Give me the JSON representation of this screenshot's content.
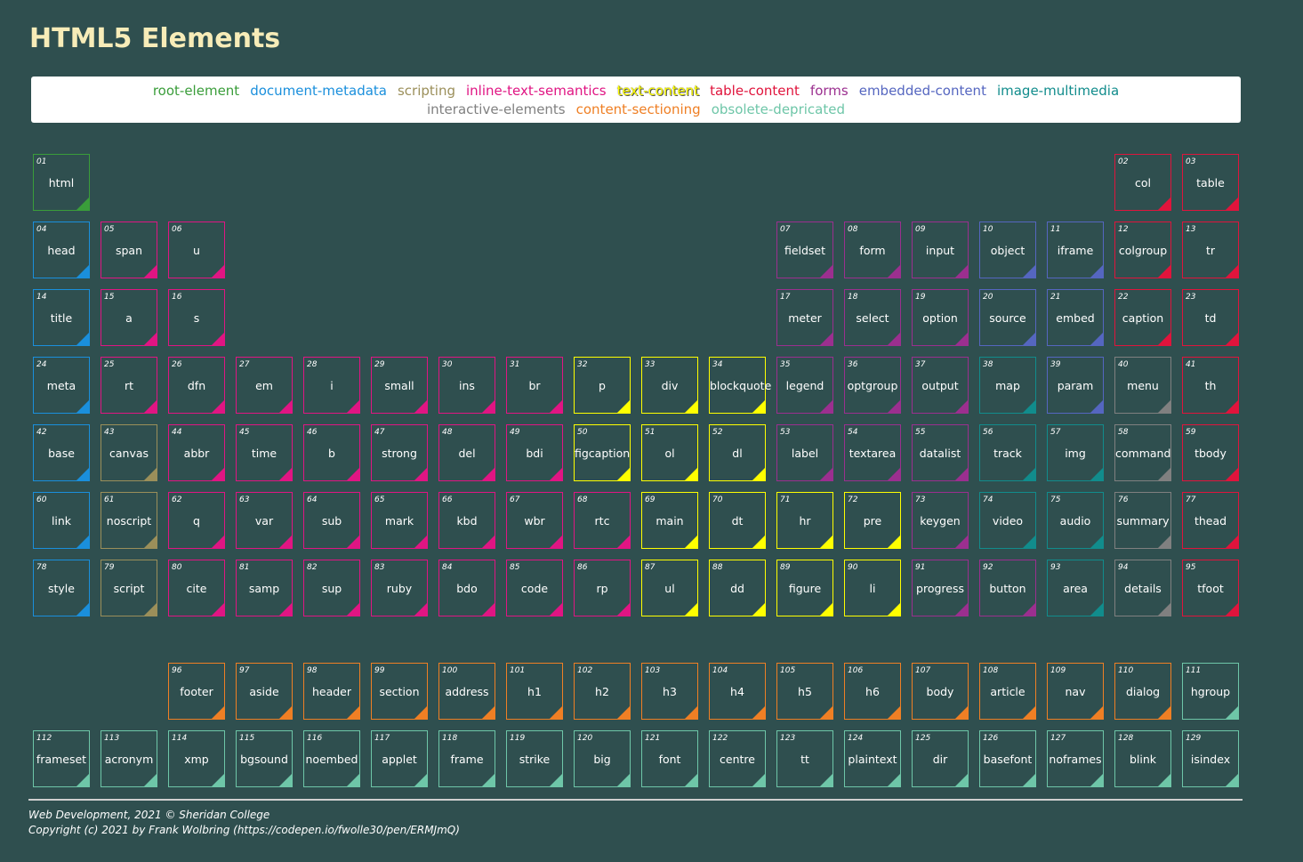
{
  "page": {
    "title": "HTML5 Elements"
  },
  "colors": {
    "background": "#2f4f4f",
    "title": "#f7ecb8",
    "root-element": "#3a9d3a",
    "document-metadata": "#1a8fdc",
    "scripting": "#9b8f5a",
    "inline-text-semantics": "#e01583",
    "text-content": "#ffff00",
    "table-content": "#e0143c",
    "forms": "#9b2f8f",
    "embedded-content": "#5566c0",
    "image-multimedia": "#118c8c",
    "interactive-elements": "#808080",
    "content-sectioning": "#ef7f24",
    "obsolete-depricated": "#6ec6a8"
  },
  "legend": {
    "row1": [
      {
        "key": "root-element",
        "label": "root-element"
      },
      {
        "key": "document-metadata",
        "label": "document-metadata"
      },
      {
        "key": "scripting",
        "label": "scripting"
      },
      {
        "key": "inline-text-semantics",
        "label": "inline-text-semantics"
      },
      {
        "key": "text-content",
        "label": "text-content"
      },
      {
        "key": "table-content",
        "label": "table-content"
      },
      {
        "key": "forms",
        "label": "forms"
      },
      {
        "key": "embedded-content",
        "label": "embedded-content"
      },
      {
        "key": "image-multimedia",
        "label": "image-multimedia"
      }
    ],
    "row2": [
      {
        "key": "interactive-elements",
        "label": "interactive-elements"
      },
      {
        "key": "content-sectioning",
        "label": "content-sectioning"
      },
      {
        "key": "obsolete-depricated",
        "label": "obsolete-depricated"
      }
    ]
  },
  "elements": [
    {
      "num": "01",
      "name": "html",
      "cat": "root-element",
      "row": 0,
      "col": 0
    },
    {
      "num": "02",
      "name": "col",
      "cat": "table-content",
      "row": 0,
      "col": 16
    },
    {
      "num": "03",
      "name": "table",
      "cat": "table-content",
      "row": 0,
      "col": 17
    },
    {
      "num": "04",
      "name": "head",
      "cat": "document-metadata",
      "row": 1,
      "col": 0
    },
    {
      "num": "05",
      "name": "span",
      "cat": "inline-text-semantics",
      "row": 1,
      "col": 1
    },
    {
      "num": "06",
      "name": "u",
      "cat": "inline-text-semantics",
      "row": 1,
      "col": 2
    },
    {
      "num": "07",
      "name": "fieldset",
      "cat": "forms",
      "row": 1,
      "col": 11
    },
    {
      "num": "08",
      "name": "form",
      "cat": "forms",
      "row": 1,
      "col": 12
    },
    {
      "num": "09",
      "name": "input",
      "cat": "forms",
      "row": 1,
      "col": 13
    },
    {
      "num": "10",
      "name": "object",
      "cat": "embedded-content",
      "row": 1,
      "col": 14
    },
    {
      "num": "11",
      "name": "iframe",
      "cat": "embedded-content",
      "row": 1,
      "col": 15
    },
    {
      "num": "12",
      "name": "colgroup",
      "cat": "table-content",
      "row": 1,
      "col": 16
    },
    {
      "num": "13",
      "name": "tr",
      "cat": "table-content",
      "row": 1,
      "col": 17
    },
    {
      "num": "14",
      "name": "title",
      "cat": "document-metadata",
      "row": 2,
      "col": 0
    },
    {
      "num": "15",
      "name": "a",
      "cat": "inline-text-semantics",
      "row": 2,
      "col": 1
    },
    {
      "num": "16",
      "name": "s",
      "cat": "inline-text-semantics",
      "row": 2,
      "col": 2
    },
    {
      "num": "17",
      "name": "meter",
      "cat": "forms",
      "row": 2,
      "col": 11
    },
    {
      "num": "18",
      "name": "select",
      "cat": "forms",
      "row": 2,
      "col": 12
    },
    {
      "num": "19",
      "name": "option",
      "cat": "forms",
      "row": 2,
      "col": 13
    },
    {
      "num": "20",
      "name": "source",
      "cat": "embedded-content",
      "row": 2,
      "col": 14
    },
    {
      "num": "21",
      "name": "embed",
      "cat": "embedded-content",
      "row": 2,
      "col": 15
    },
    {
      "num": "22",
      "name": "caption",
      "cat": "table-content",
      "row": 2,
      "col": 16
    },
    {
      "num": "23",
      "name": "td",
      "cat": "table-content",
      "row": 2,
      "col": 17
    },
    {
      "num": "24",
      "name": "meta",
      "cat": "document-metadata",
      "row": 3,
      "col": 0
    },
    {
      "num": "25",
      "name": "rt",
      "cat": "inline-text-semantics",
      "row": 3,
      "col": 1
    },
    {
      "num": "26",
      "name": "dfn",
      "cat": "inline-text-semantics",
      "row": 3,
      "col": 2
    },
    {
      "num": "27",
      "name": "em",
      "cat": "inline-text-semantics",
      "row": 3,
      "col": 3
    },
    {
      "num": "28",
      "name": "i",
      "cat": "inline-text-semantics",
      "row": 3,
      "col": 4
    },
    {
      "num": "29",
      "name": "small",
      "cat": "inline-text-semantics",
      "row": 3,
      "col": 5
    },
    {
      "num": "30",
      "name": "ins",
      "cat": "inline-text-semantics",
      "row": 3,
      "col": 6
    },
    {
      "num": "31",
      "name": "br",
      "cat": "inline-text-semantics",
      "row": 3,
      "col": 7
    },
    {
      "num": "32",
      "name": "p",
      "cat": "text-content",
      "row": 3,
      "col": 8
    },
    {
      "num": "33",
      "name": "div",
      "cat": "text-content",
      "row": 3,
      "col": 9
    },
    {
      "num": "34",
      "name": "blockquote",
      "cat": "text-content",
      "row": 3,
      "col": 10
    },
    {
      "num": "35",
      "name": "legend",
      "cat": "forms",
      "row": 3,
      "col": 11
    },
    {
      "num": "36",
      "name": "optgroup",
      "cat": "forms",
      "row": 3,
      "col": 12
    },
    {
      "num": "37",
      "name": "output",
      "cat": "forms",
      "row": 3,
      "col": 13
    },
    {
      "num": "38",
      "name": "map",
      "cat": "image-multimedia",
      "row": 3,
      "col": 14
    },
    {
      "num": "39",
      "name": "param",
      "cat": "embedded-content",
      "row": 3,
      "col": 15
    },
    {
      "num": "40",
      "name": "menu",
      "cat": "interactive-elements",
      "row": 3,
      "col": 16
    },
    {
      "num": "41",
      "name": "th",
      "cat": "table-content",
      "row": 3,
      "col": 17
    },
    {
      "num": "42",
      "name": "base",
      "cat": "document-metadata",
      "row": 4,
      "col": 0
    },
    {
      "num": "43",
      "name": "canvas",
      "cat": "scripting",
      "row": 4,
      "col": 1
    },
    {
      "num": "44",
      "name": "abbr",
      "cat": "inline-text-semantics",
      "row": 4,
      "col": 2
    },
    {
      "num": "45",
      "name": "time",
      "cat": "inline-text-semantics",
      "row": 4,
      "col": 3
    },
    {
      "num": "46",
      "name": "b",
      "cat": "inline-text-semantics",
      "row": 4,
      "col": 4
    },
    {
      "num": "47",
      "name": "strong",
      "cat": "inline-text-semantics",
      "row": 4,
      "col": 5
    },
    {
      "num": "48",
      "name": "del",
      "cat": "inline-text-semantics",
      "row": 4,
      "col": 6
    },
    {
      "num": "49",
      "name": "bdi",
      "cat": "inline-text-semantics",
      "row": 4,
      "col": 7
    },
    {
      "num": "50",
      "name": "figcaption",
      "cat": "text-content",
      "row": 4,
      "col": 8
    },
    {
      "num": "51",
      "name": "ol",
      "cat": "text-content",
      "row": 4,
      "col": 9
    },
    {
      "num": "52",
      "name": "dl",
      "cat": "text-content",
      "row": 4,
      "col": 10
    },
    {
      "num": "53",
      "name": "label",
      "cat": "forms",
      "row": 4,
      "col": 11
    },
    {
      "num": "54",
      "name": "textarea",
      "cat": "forms",
      "row": 4,
      "col": 12
    },
    {
      "num": "55",
      "name": "datalist",
      "cat": "forms",
      "row": 4,
      "col": 13
    },
    {
      "num": "56",
      "name": "track",
      "cat": "image-multimedia",
      "row": 4,
      "col": 14
    },
    {
      "num": "57",
      "name": "img",
      "cat": "image-multimedia",
      "row": 4,
      "col": 15
    },
    {
      "num": "58",
      "name": "command",
      "cat": "interactive-elements",
      "row": 4,
      "col": 16
    },
    {
      "num": "59",
      "name": "tbody",
      "cat": "table-content",
      "row": 4,
      "col": 17
    },
    {
      "num": "60",
      "name": "link",
      "cat": "document-metadata",
      "row": 5,
      "col": 0
    },
    {
      "num": "61",
      "name": "noscript",
      "cat": "scripting",
      "row": 5,
      "col": 1
    },
    {
      "num": "62",
      "name": "q",
      "cat": "inline-text-semantics",
      "row": 5,
      "col": 2
    },
    {
      "num": "63",
      "name": "var",
      "cat": "inline-text-semantics",
      "row": 5,
      "col": 3
    },
    {
      "num": "64",
      "name": "sub",
      "cat": "inline-text-semantics",
      "row": 5,
      "col": 4
    },
    {
      "num": "65",
      "name": "mark",
      "cat": "inline-text-semantics",
      "row": 5,
      "col": 5
    },
    {
      "num": "66",
      "name": "kbd",
      "cat": "inline-text-semantics",
      "row": 5,
      "col": 6
    },
    {
      "num": "67",
      "name": "wbr",
      "cat": "inline-text-semantics",
      "row": 5,
      "col": 7
    },
    {
      "num": "68",
      "name": "rtc",
      "cat": "inline-text-semantics",
      "row": 5,
      "col": 8
    },
    {
      "num": "69",
      "name": "main",
      "cat": "text-content",
      "row": 5,
      "col": 9
    },
    {
      "num": "70",
      "name": "dt",
      "cat": "text-content",
      "row": 5,
      "col": 10
    },
    {
      "num": "71",
      "name": "hr",
      "cat": "text-content",
      "row": 5,
      "col": 11
    },
    {
      "num": "72",
      "name": "pre",
      "cat": "text-content",
      "row": 5,
      "col": 12
    },
    {
      "num": "73",
      "name": "keygen",
      "cat": "forms",
      "row": 5,
      "col": 13
    },
    {
      "num": "74",
      "name": "video",
      "cat": "image-multimedia",
      "row": 5,
      "col": 14
    },
    {
      "num": "75",
      "name": "audio",
      "cat": "image-multimedia",
      "row": 5,
      "col": 15
    },
    {
      "num": "76",
      "name": "summary",
      "cat": "interactive-elements",
      "row": 5,
      "col": 16
    },
    {
      "num": "77",
      "name": "thead",
      "cat": "table-content",
      "row": 5,
      "col": 17
    },
    {
      "num": "78",
      "name": "style",
      "cat": "document-metadata",
      "row": 6,
      "col": 0
    },
    {
      "num": "79",
      "name": "script",
      "cat": "scripting",
      "row": 6,
      "col": 1
    },
    {
      "num": "80",
      "name": "cite",
      "cat": "inline-text-semantics",
      "row": 6,
      "col": 2
    },
    {
      "num": "81",
      "name": "samp",
      "cat": "inline-text-semantics",
      "row": 6,
      "col": 3
    },
    {
      "num": "82",
      "name": "sup",
      "cat": "inline-text-semantics",
      "row": 6,
      "col": 4
    },
    {
      "num": "83",
      "name": "ruby",
      "cat": "inline-text-semantics",
      "row": 6,
      "col": 5
    },
    {
      "num": "84",
      "name": "bdo",
      "cat": "inline-text-semantics",
      "row": 6,
      "col": 6
    },
    {
      "num": "85",
      "name": "code",
      "cat": "inline-text-semantics",
      "row": 6,
      "col": 7
    },
    {
      "num": "86",
      "name": "rp",
      "cat": "inline-text-semantics",
      "row": 6,
      "col": 8
    },
    {
      "num": "87",
      "name": "ul",
      "cat": "text-content",
      "row": 6,
      "col": 9
    },
    {
      "num": "88",
      "name": "dd",
      "cat": "text-content",
      "row": 6,
      "col": 10
    },
    {
      "num": "89",
      "name": "figure",
      "cat": "text-content",
      "row": 6,
      "col": 11
    },
    {
      "num": "90",
      "name": "li",
      "cat": "text-content",
      "row": 6,
      "col": 12
    },
    {
      "num": "91",
      "name": "progress",
      "cat": "forms",
      "row": 6,
      "col": 13
    },
    {
      "num": "92",
      "name": "button",
      "cat": "forms",
      "row": 6,
      "col": 14
    },
    {
      "num": "93",
      "name": "area",
      "cat": "image-multimedia",
      "row": 6,
      "col": 15
    },
    {
      "num": "94",
      "name": "details",
      "cat": "interactive-elements",
      "row": 6,
      "col": 16
    },
    {
      "num": "95",
      "name": "tfoot",
      "cat": "table-content",
      "row": 6,
      "col": 17
    },
    {
      "num": "96",
      "name": "footer",
      "cat": "content-sectioning",
      "row": 7,
      "col": 2
    },
    {
      "num": "97",
      "name": "aside",
      "cat": "content-sectioning",
      "row": 7,
      "col": 3
    },
    {
      "num": "98",
      "name": "header",
      "cat": "content-sectioning",
      "row": 7,
      "col": 4
    },
    {
      "num": "99",
      "name": "section",
      "cat": "content-sectioning",
      "row": 7,
      "col": 5
    },
    {
      "num": "100",
      "name": "address",
      "cat": "content-sectioning",
      "row": 7,
      "col": 6
    },
    {
      "num": "101",
      "name": "h1",
      "cat": "content-sectioning",
      "row": 7,
      "col": 7
    },
    {
      "num": "102",
      "name": "h2",
      "cat": "content-sectioning",
      "row": 7,
      "col": 8
    },
    {
      "num": "103",
      "name": "h3",
      "cat": "content-sectioning",
      "row": 7,
      "col": 9
    },
    {
      "num": "104",
      "name": "h4",
      "cat": "content-sectioning",
      "row": 7,
      "col": 10
    },
    {
      "num": "105",
      "name": "h5",
      "cat": "content-sectioning",
      "row": 7,
      "col": 11
    },
    {
      "num": "106",
      "name": "h6",
      "cat": "content-sectioning",
      "row": 7,
      "col": 12
    },
    {
      "num": "107",
      "name": "body",
      "cat": "content-sectioning",
      "row": 7,
      "col": 13
    },
    {
      "num": "108",
      "name": "article",
      "cat": "content-sectioning",
      "row": 7,
      "col": 14
    },
    {
      "num": "109",
      "name": "nav",
      "cat": "content-sectioning",
      "row": 7,
      "col": 15
    },
    {
      "num": "110",
      "name": "dialog",
      "cat": "content-sectioning",
      "row": 7,
      "col": 16
    },
    {
      "num": "111",
      "name": "hgroup",
      "cat": "obsolete-depricated",
      "row": 7,
      "col": 17
    },
    {
      "num": "112",
      "name": "frameset",
      "cat": "obsolete-depricated",
      "row": 8,
      "col": 0
    },
    {
      "num": "113",
      "name": "acronym",
      "cat": "obsolete-depricated",
      "row": 8,
      "col": 1
    },
    {
      "num": "114",
      "name": "xmp",
      "cat": "obsolete-depricated",
      "row": 8,
      "col": 2
    },
    {
      "num": "115",
      "name": "bgsound",
      "cat": "obsolete-depricated",
      "row": 8,
      "col": 3
    },
    {
      "num": "116",
      "name": "noembed",
      "cat": "obsolete-depricated",
      "row": 8,
      "col": 4
    },
    {
      "num": "117",
      "name": "applet",
      "cat": "obsolete-depricated",
      "row": 8,
      "col": 5
    },
    {
      "num": "118",
      "name": "frame",
      "cat": "obsolete-depricated",
      "row": 8,
      "col": 6
    },
    {
      "num": "119",
      "name": "strike",
      "cat": "obsolete-depricated",
      "row": 8,
      "col": 7
    },
    {
      "num": "120",
      "name": "big",
      "cat": "obsolete-depricated",
      "row": 8,
      "col": 8
    },
    {
      "num": "121",
      "name": "font",
      "cat": "obsolete-depricated",
      "row": 8,
      "col": 9
    },
    {
      "num": "122",
      "name": "centre",
      "cat": "obsolete-depricated",
      "row": 8,
      "col": 10
    },
    {
      "num": "123",
      "name": "tt",
      "cat": "obsolete-depricated",
      "row": 8,
      "col": 11
    },
    {
      "num": "124",
      "name": "plaintext",
      "cat": "obsolete-depricated",
      "row": 8,
      "col": 12
    },
    {
      "num": "125",
      "name": "dir",
      "cat": "obsolete-depricated",
      "row": 8,
      "col": 13
    },
    {
      "num": "126",
      "name": "basefont",
      "cat": "obsolete-depricated",
      "row": 8,
      "col": 14
    },
    {
      "num": "127",
      "name": "noframes",
      "cat": "obsolete-depricated",
      "row": 8,
      "col": 15
    },
    {
      "num": "128",
      "name": "blink",
      "cat": "obsolete-depricated",
      "row": 8,
      "col": 16
    },
    {
      "num": "129",
      "name": "isindex",
      "cat": "obsolete-depricated",
      "row": 8,
      "col": 17
    }
  ],
  "footer": {
    "line1": "Web Development, 2021 © Sheridan College",
    "line2": "Copyright (c) 2021 by Frank Wolbring (https://codepen.io/fwolle30/pen/ERMJmQ)"
  }
}
